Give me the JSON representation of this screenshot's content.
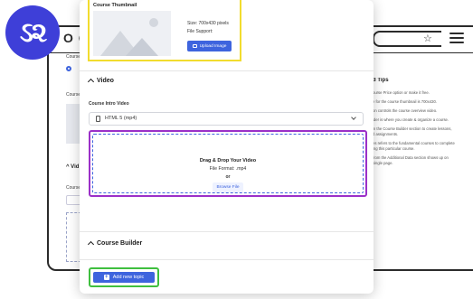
{
  "logo": {
    "text": "ઽ૨"
  },
  "background": {
    "chrome_text": "O C",
    "left_labels": [
      "Course",
      "Course",
      "Course lt"
    ],
    "video_title": "^ Vid",
    "select_text": "HY",
    "tips": {
      "title": "d Tips",
      "lines": [
        "ourse Price option or make it free.",
        "",
        "e for the course thumbnail is 700x430.",
        "",
        "on controls the course overview video.",
        "",
        "lder is where you create & organize a course.",
        "",
        "in the Course Builder section to create lessons,",
        "d assignments.",
        "",
        "es refers to the fundamental courses to complete",
        "ing this particular course.",
        "",
        "from the Additional Data section shows up on",
        "single page."
      ]
    }
  },
  "thumbnail": {
    "label": "Course Thumbnail",
    "size_text": "Size: 700x430 pixels",
    "file_support_text": "File Support:",
    "upload_label": "Upload Image"
  },
  "video": {
    "section_title": "Video",
    "intro_label": "Course Intro Video",
    "source_selected": "HTML 5 (mp4)",
    "drop_title": "Drag & Drop Your Video",
    "file_format": "File Format: .mp4",
    "or_text": "or",
    "browse_label": "Browse File"
  },
  "course_builder": {
    "section_title": "Course Builder",
    "add_topic_label": "Add new topic"
  },
  "colors": {
    "accent": "#3e64de",
    "thumb_highlight": "#f2dc2e",
    "video_highlight": "#9b30c8",
    "add_topic_highlight": "#3fbf3f",
    "logo": "#3e3fd8"
  }
}
